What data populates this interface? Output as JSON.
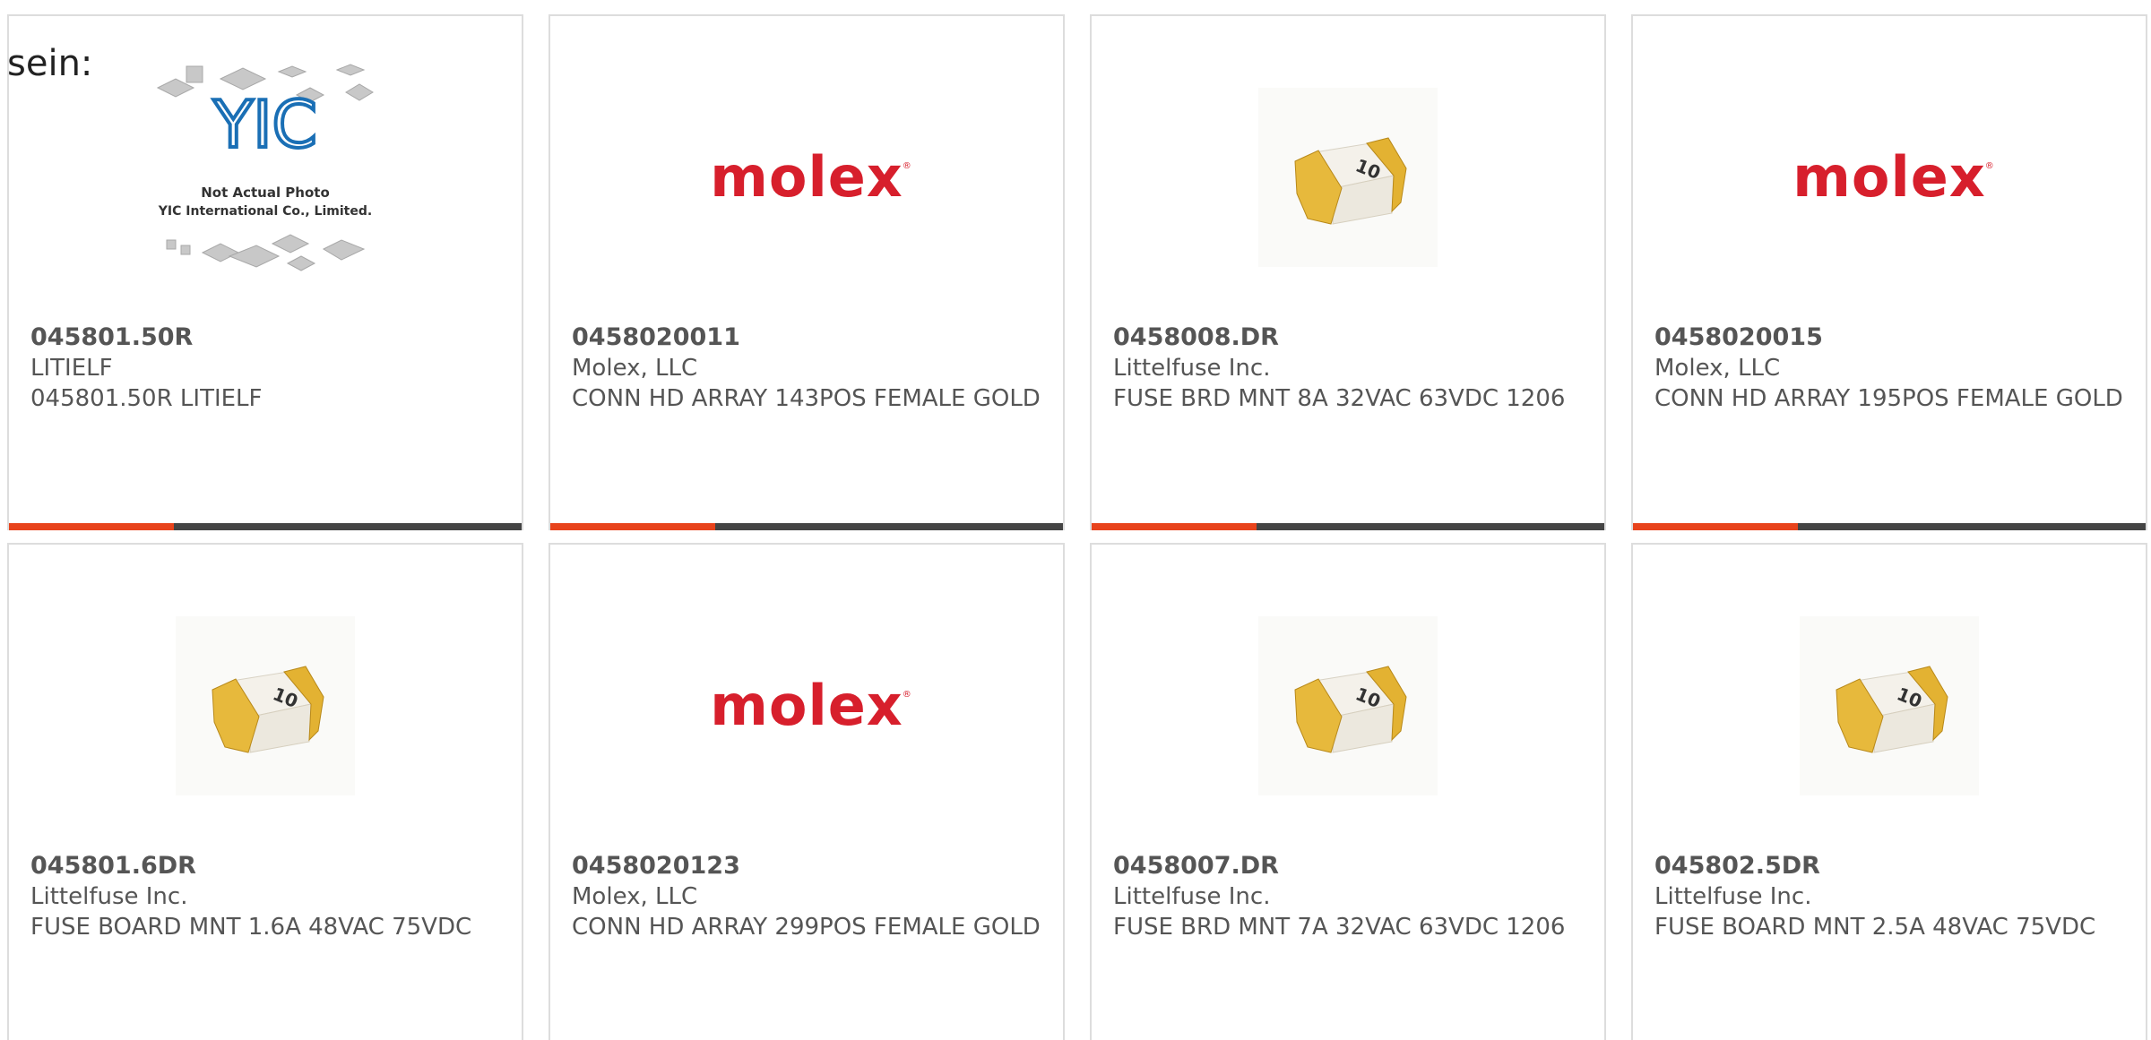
{
  "lead_text": "sein:",
  "colors": {
    "accent": "#e8431c",
    "bar": "#444444",
    "molex": "#d71f2c"
  },
  "placeholder_image": {
    "logo": "YIC",
    "line1": "Not Actual Photo",
    "line2": "YIC International Co., Limited."
  },
  "molex_logo_text": "molex",
  "fuse_marking": "10",
  "products": [
    {
      "image": "yic-placeholder",
      "pn": "045801.50R",
      "mfr": "LITIELF",
      "desc": "045801.50R LITIELF"
    },
    {
      "image": "molex-logo",
      "pn": "0458020011",
      "mfr": "Molex, LLC",
      "desc": "CONN HD ARRAY 143POS FEMALE GOLD"
    },
    {
      "image": "fuse-chip",
      "pn": "0458008.DR",
      "mfr": "Littelfuse Inc.",
      "desc": "FUSE BRD MNT 8A 32VAC 63VDC 1206"
    },
    {
      "image": "molex-logo",
      "pn": "0458020015",
      "mfr": "Molex, LLC",
      "desc": "CONN HD ARRAY 195POS FEMALE GOLD"
    },
    {
      "image": "fuse-chip",
      "pn": "045801.6DR",
      "mfr": "Littelfuse Inc.",
      "desc": "FUSE BOARD MNT 1.6A 48VAC 75VDC"
    },
    {
      "image": "molex-logo",
      "pn": "0458020123",
      "mfr": "Molex, LLC",
      "desc": "CONN HD ARRAY 299POS FEMALE GOLD"
    },
    {
      "image": "fuse-chip",
      "pn": "0458007.DR",
      "mfr": "Littelfuse Inc.",
      "desc": "FUSE BRD MNT 7A 32VAC 63VDC 1206"
    },
    {
      "image": "fuse-chip",
      "pn": "045802.5DR",
      "mfr": "Littelfuse Inc.",
      "desc": "FUSE BOARD MNT 2.5A 48VAC 75VDC"
    }
  ]
}
